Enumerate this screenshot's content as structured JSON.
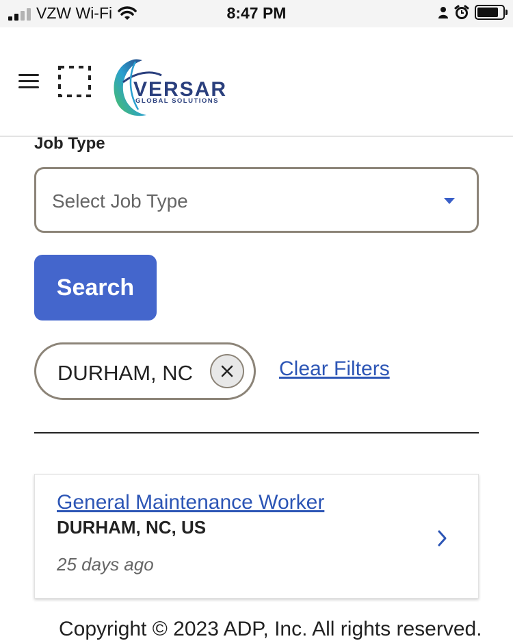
{
  "status_bar": {
    "carrier": "VZW Wi-Fi",
    "time": "8:47 PM"
  },
  "header": {
    "logo_name": "VERSAR",
    "logo_tagline": "GLOBAL SOLUTIONS"
  },
  "filters": {
    "job_type_label": "Job Type",
    "job_type_placeholder": "Select Job Type",
    "search_label": "Search",
    "active_filter": "DURHAM, NC",
    "clear_filters_label": "Clear Filters"
  },
  "results": [
    {
      "title": "General Maintenance Worker",
      "location": "DURHAM, NC, US",
      "posted": "25 days ago"
    }
  ],
  "footer": {
    "copyright": "Copyright © 2023 ADP, Inc. All rights reserved."
  },
  "colors": {
    "accent": "#4466cc",
    "link": "#2c55b5",
    "border": "#8c8478"
  }
}
